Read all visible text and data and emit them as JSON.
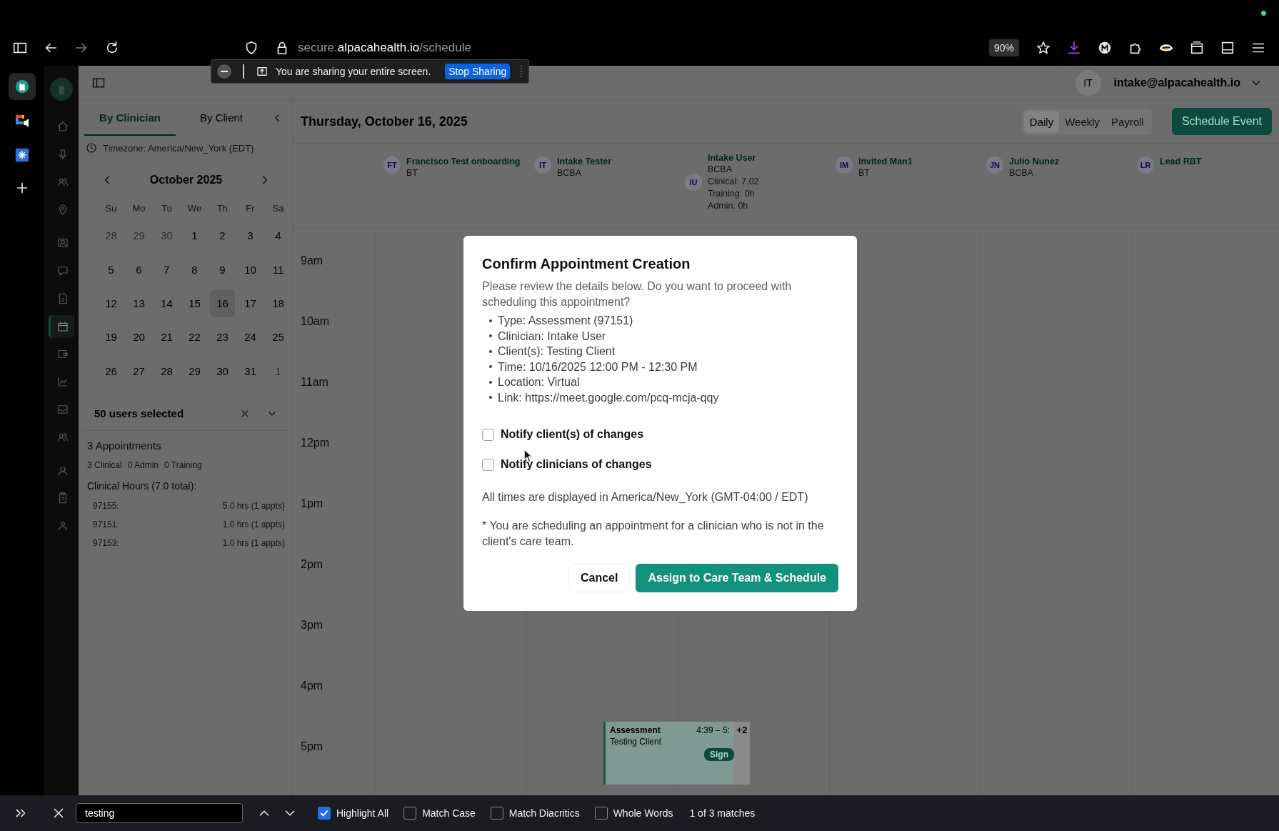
{
  "browser": {
    "url_prefix": "secure.",
    "url_domain": "alpacahealth.io",
    "url_path": "/schedule",
    "zoom": "90%"
  },
  "side_apps": [
    {
      "selected": true
    },
    {
      "selected": false
    },
    {
      "selected": false
    }
  ],
  "sharing_bar": {
    "message": "You are sharing your entire screen.",
    "button": "Stop Sharing"
  },
  "nav_items": [
    {
      "selected": false
    },
    {
      "selected": false
    },
    {
      "selected": false
    },
    {
      "selected": false
    },
    {
      "selected": false
    },
    {
      "selected": false
    },
    {
      "selected": false
    },
    {
      "selected": true
    },
    {
      "selected": false
    },
    {
      "selected": false
    },
    {
      "selected": false
    },
    {
      "selected": false
    },
    {
      "selected": false
    },
    {
      "selected": false
    },
    {
      "selected": false
    }
  ],
  "account": {
    "initials": "IT",
    "email": "intake@alpacahealth.io"
  },
  "view_tabs": [
    {
      "label": "By Clinician",
      "selected": true
    },
    {
      "label": "By Client",
      "selected": false
    }
  ],
  "timezone": "Timezone: America/New_York (EDT)",
  "calendar": {
    "month": "October 2025",
    "weekdays": [
      "Su",
      "Mo",
      "Tu",
      "We",
      "Th",
      "Fr",
      "Sa"
    ],
    "days": [
      {
        "label": "28",
        "muted": true,
        "selected": false
      },
      {
        "label": "29",
        "muted": true,
        "selected": false
      },
      {
        "label": "30",
        "muted": true,
        "selected": false
      },
      {
        "label": "1",
        "muted": false,
        "selected": false
      },
      {
        "label": "2",
        "muted": false,
        "selected": false
      },
      {
        "label": "3",
        "muted": false,
        "selected": false
      },
      {
        "label": "4",
        "muted": false,
        "selected": false
      },
      {
        "label": "5",
        "muted": false,
        "selected": false
      },
      {
        "label": "6",
        "muted": false,
        "selected": false
      },
      {
        "label": "7",
        "muted": false,
        "selected": false
      },
      {
        "label": "8",
        "muted": false,
        "selected": false
      },
      {
        "label": "9",
        "muted": false,
        "selected": false
      },
      {
        "label": "10",
        "muted": false,
        "selected": false
      },
      {
        "label": "11",
        "muted": false,
        "selected": false
      },
      {
        "label": "12",
        "muted": false,
        "selected": false
      },
      {
        "label": "13",
        "muted": false,
        "selected": false
      },
      {
        "label": "14",
        "muted": false,
        "selected": false
      },
      {
        "label": "15",
        "muted": false,
        "selected": false
      },
      {
        "label": "16",
        "muted": false,
        "selected": true
      },
      {
        "label": "17",
        "muted": false,
        "selected": false
      },
      {
        "label": "18",
        "muted": false,
        "selected": false
      },
      {
        "label": "19",
        "muted": false,
        "selected": false
      },
      {
        "label": "20",
        "muted": false,
        "selected": false
      },
      {
        "label": "21",
        "muted": false,
        "selected": false
      },
      {
        "label": "22",
        "muted": false,
        "selected": false
      },
      {
        "label": "23",
        "muted": false,
        "selected": false
      },
      {
        "label": "24",
        "muted": false,
        "selected": false
      },
      {
        "label": "25",
        "muted": false,
        "selected": false
      },
      {
        "label": "26",
        "muted": false,
        "selected": false
      },
      {
        "label": "27",
        "muted": false,
        "selected": false
      },
      {
        "label": "28",
        "muted": false,
        "selected": false
      },
      {
        "label": "29",
        "muted": false,
        "selected": false
      },
      {
        "label": "30",
        "muted": false,
        "selected": false
      },
      {
        "label": "31",
        "muted": false,
        "selected": false
      },
      {
        "label": "1",
        "muted": true,
        "selected": false
      }
    ]
  },
  "user_filter": "50 users selected",
  "summary": {
    "title": "3 Appointments",
    "counts": [
      "3 Clinical",
      "0 Admin",
      "0 Training"
    ],
    "hours_title": "Clinical Hours (7.0 total):",
    "rows": [
      {
        "code": "97155:",
        "hours": "5.0 hrs (1 appts)"
      },
      {
        "code": "97151:",
        "hours": "1.0 hrs (1 appts)"
      },
      {
        "code": "97153:",
        "hours": "1.0 hrs (1 appts)"
      }
    ]
  },
  "date_title": "Thursday, October 16, 2025",
  "view_modes": [
    {
      "label": "Daily",
      "selected": true
    },
    {
      "label": "Weekly",
      "selected": false
    },
    {
      "label": "Payroll",
      "selected": false
    }
  ],
  "schedule_button": "Schedule Event",
  "clinicians": [
    {
      "initials": "FT",
      "name": "Francisco Test onboarding",
      "role": "BT"
    },
    {
      "initials": "IT",
      "name": "Intake Tester",
      "role": "BCBA"
    },
    {
      "initials": "IU",
      "name": "Intake User",
      "role": "BCBA",
      "stats": [
        "Clinical: 7.02",
        "Training: 0h",
        "Admin: 0h"
      ]
    },
    {
      "initials": "IM",
      "name": "Invited Man1",
      "role": "BT"
    },
    {
      "initials": "JN",
      "name": "Julio Nunez",
      "role": "BCBA"
    },
    {
      "initials": "LR",
      "name": "Lead RBT"
    }
  ],
  "hours": [
    "9am",
    "10am",
    "11am",
    "12pm",
    "1pm",
    "2pm",
    "3pm",
    "4pm",
    "5pm"
  ],
  "appointment": {
    "title": "Assessment",
    "time": "4:39 – 5:",
    "client": "Testing Client",
    "badge": "Sign",
    "more": "+2"
  },
  "dialog": {
    "title": "Confirm Appointment Creation",
    "intro": "Please review the details below. Do you want to proceed with scheduling this appointment?",
    "details": [
      "Type: Assessment (97151)",
      "Clinician: Intake User",
      "Client(s): Testing Client",
      "Time: 10/16/2025 12:00 PM - 12:30 PM",
      "Location: Virtual",
      "Link: https://meet.google.com/pcq-mcja-qqy"
    ],
    "options": [
      {
        "label": "Notify client(s) of changes",
        "checked": false
      },
      {
        "label": "Notify clinicians of changes",
        "checked": false
      }
    ],
    "timezone_note": "All times are displayed in America/New_York (GMT-04:00 / EDT)",
    "warning": "* You are scheduling an appointment for a clinician who is not in the client's care team.",
    "cancel": "Cancel",
    "confirm": "Assign to Care Team & Schedule"
  },
  "find_bar": {
    "query": "testing",
    "options": [
      {
        "label": "Highlight All",
        "checked": true
      },
      {
        "label": "Match Case",
        "checked": false
      },
      {
        "label": "Match Diacritics",
        "checked": false
      },
      {
        "label": "Whole Words",
        "checked": false
      }
    ],
    "status": "1 of 3 matches"
  }
}
